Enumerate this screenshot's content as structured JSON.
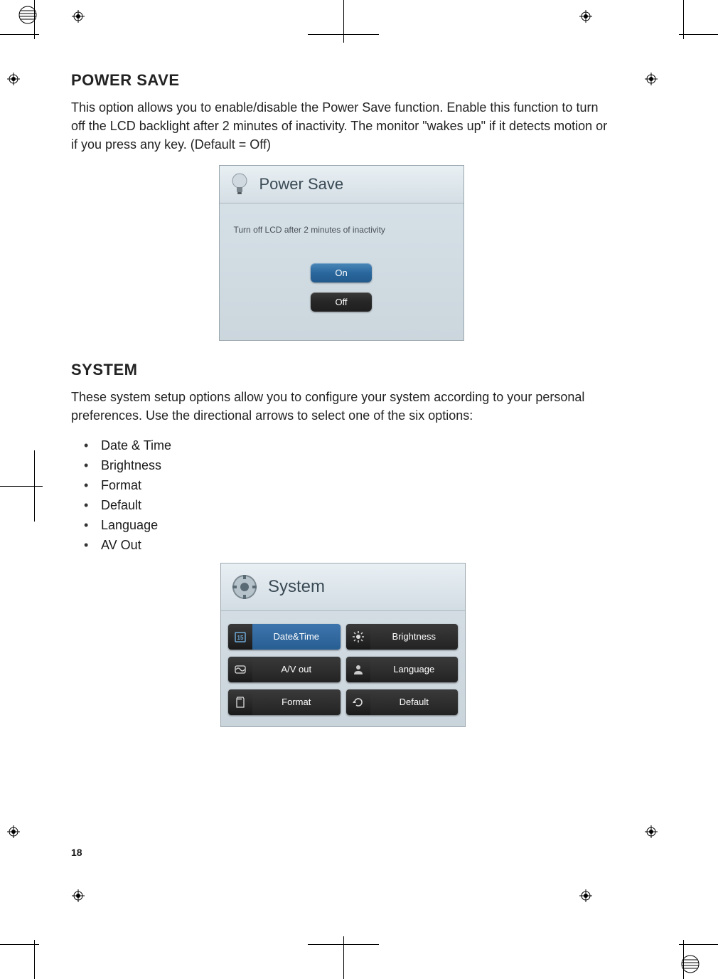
{
  "page_number": "18",
  "sections": {
    "power_save": {
      "title": "POWER SAVE",
      "body": "This option allows you to enable/disable the Power Save function. Enable this function to turn off the LCD backlight after 2 minutes of inactivity. The monitor \"wakes up\" if it detects motion or if you press any key. (Default = Off)",
      "screenshot": {
        "header": "Power Save",
        "caption": "Turn off LCD after 2 minutes of inactivity",
        "on_label": "On",
        "off_label": "Off"
      }
    },
    "system": {
      "title": "SYSTEM",
      "body": "These system setup options allow you to configure your system according to your personal preferences. Use the directional arrows to select one of the six options:",
      "options": [
        "Date & Time",
        "Brightness",
        "Format",
        "Default",
        "Language",
        "AV Out"
      ],
      "screenshot": {
        "header": "System",
        "items": {
          "date_time": "Date&Time",
          "brightness": "Brightness",
          "av_out": "A/V out",
          "language": "Language",
          "format": "Format",
          "default": "Default"
        }
      }
    }
  }
}
